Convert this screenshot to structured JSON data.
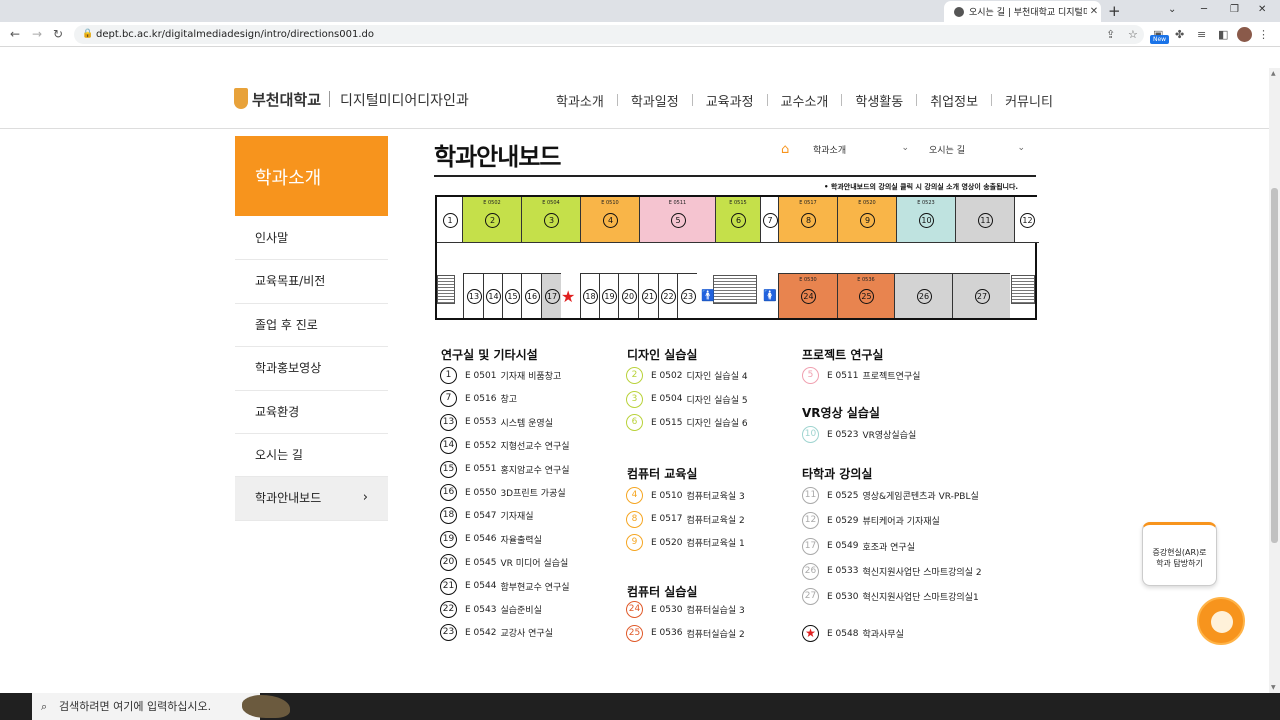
{
  "browser": {
    "tab_title": "오시는 길 | 부천대학교 디지털미",
    "url": "dept.bc.ac.kr/digitalmediadesign/intro/directions001.do",
    "new_badge": "New"
  },
  "header": {
    "school_name": "부천대학교",
    "dept_name": "디지털미디어디자인과",
    "nav": [
      "학과소개",
      "학과일정",
      "교육과정",
      "교수소개",
      "학생활동",
      "취업정보",
      "커뮤니티"
    ]
  },
  "sidebar": {
    "title": "학과소개",
    "items": [
      {
        "label": "인사말"
      },
      {
        "label": "교육목표/비전"
      },
      {
        "label": "졸업 후 진로"
      },
      {
        "label": "학과홍보영상"
      },
      {
        "label": "교육환경"
      },
      {
        "label": "오시는 길"
      },
      {
        "label": "학과안내보드"
      }
    ],
    "active_index": 6
  },
  "content": {
    "title": "학과안내보드",
    "breadcrumb": [
      "학과소개",
      "오시는 길"
    ],
    "notice": "• 학과안내보드의 강의실 클릭 시 강의실 소개 영상이 송출됩니다."
  },
  "map": {
    "top_rooms": [
      {
        "num": "1",
        "code": "",
        "color": "#ffffff"
      },
      {
        "num": "2",
        "code": "E 0502",
        "color": "#c5e04a"
      },
      {
        "num": "3",
        "code": "E 0504",
        "color": "#c5e04a"
      },
      {
        "num": "4",
        "code": "E 0510",
        "color": "#f9b548"
      },
      {
        "num": "5",
        "code": "E 0511",
        "color": "#f5c4d0"
      },
      {
        "num": "6",
        "code": "E 0515",
        "color": "#c5e04a"
      },
      {
        "num": "7",
        "code": "",
        "color": "#ffffff"
      },
      {
        "num": "8",
        "code": "E 0517",
        "color": "#f9b548"
      },
      {
        "num": "9",
        "code": "E 0520",
        "color": "#f9b548"
      },
      {
        "num": "10",
        "code": "E 0523",
        "color": "#bfe3e0"
      },
      {
        "num": "11",
        "code": "",
        "color": "#d3d3d3"
      },
      {
        "num": "12",
        "code": "",
        "color": "#ffffff"
      }
    ],
    "bottom_rooms": [
      {
        "num": "13",
        "code": "",
        "color": "#ffffff"
      },
      {
        "num": "14",
        "code": "",
        "color": "#ffffff"
      },
      {
        "num": "15",
        "code": "",
        "color": "#ffffff"
      },
      {
        "num": "16",
        "code": "",
        "color": "#ffffff"
      },
      {
        "num": "17",
        "code": "",
        "color": "#d3d3d3"
      },
      {
        "num": "18",
        "code": "",
        "color": "#ffffff"
      },
      {
        "num": "19",
        "code": "",
        "color": "#ffffff"
      },
      {
        "num": "20",
        "code": "",
        "color": "#ffffff"
      },
      {
        "num": "21",
        "code": "",
        "color": "#ffffff"
      },
      {
        "num": "22",
        "code": "",
        "color": "#ffffff"
      },
      {
        "num": "23",
        "code": "",
        "color": "#ffffff"
      },
      {
        "num": "24",
        "code": "E 0530",
        "color": "#e8844f"
      },
      {
        "num": "25",
        "code": "E 0536",
        "color": "#e8844f"
      },
      {
        "num": "26",
        "code": "",
        "color": "#d3d3d3"
      },
      {
        "num": "27",
        "code": "",
        "color": "#d3d3d3"
      }
    ]
  },
  "legend": {
    "col1": {
      "title": "연구실 및 기타시설",
      "items": [
        {
          "num": "1",
          "code": "E 0501",
          "name": "기자재 비품창고"
        },
        {
          "num": "7",
          "code": "E 0516",
          "name": "창고"
        },
        {
          "num": "13",
          "code": "E 0553",
          "name": "시스템 운영실"
        },
        {
          "num": "14",
          "code": "E 0552",
          "name": "지형선교수 연구실"
        },
        {
          "num": "15",
          "code": "E 0551",
          "name": "홍지암교수 연구실"
        },
        {
          "num": "16",
          "code": "E 0550",
          "name": "3D프린트 가공실"
        },
        {
          "num": "18",
          "code": "E 0547",
          "name": "기자재실"
        },
        {
          "num": "19",
          "code": "E 0546",
          "name": "자율출력실"
        },
        {
          "num": "20",
          "code": "E 0545",
          "name": "VR 미디어 실습실"
        },
        {
          "num": "21",
          "code": "E 0544",
          "name": "함부현교수 연구실"
        },
        {
          "num": "22",
          "code": "E 0543",
          "name": "실습준비실"
        },
        {
          "num": "23",
          "code": "E 0542",
          "name": "교강사 연구실"
        }
      ]
    },
    "col2": {
      "groups": [
        {
          "title": "디자인 실습실",
          "color": "#b9d23a",
          "items": [
            {
              "num": "2",
              "code": "E 0502",
              "name": "디자인 실습실 4"
            },
            {
              "num": "3",
              "code": "E 0504",
              "name": "디자인 실습실 5"
            },
            {
              "num": "6",
              "code": "E 0515",
              "name": "디자인 실습실 6"
            }
          ]
        },
        {
          "title": "컴퓨터 교육실",
          "color": "#f5a623",
          "items": [
            {
              "num": "4",
              "code": "E 0510",
              "name": "컴퓨터교육실 3"
            },
            {
              "num": "8",
              "code": "E 0517",
              "name": "컴퓨터교육실 2"
            },
            {
              "num": "9",
              "code": "E 0520",
              "name": "컴퓨터교육실 1"
            }
          ]
        },
        {
          "title": "컴퓨터 실습실",
          "color": "#e05a2a",
          "items": [
            {
              "num": "24",
              "code": "E 0530",
              "name": "컴퓨터실습실 3"
            },
            {
              "num": "25",
              "code": "E 0536",
              "name": "컴퓨터실습실 2"
            }
          ]
        }
      ]
    },
    "col3": {
      "groups": [
        {
          "title": "프로젝트 연구실",
          "color": "#f0a0b0",
          "items": [
            {
              "num": "5",
              "code": "E 0511",
              "name": "프로젝트연구실"
            }
          ]
        },
        {
          "title": "VR영상 실습실",
          "color": "#9fd4d0",
          "items": [
            {
              "num": "10",
              "code": "E 0523",
              "name": "VR영상실습실"
            }
          ]
        },
        {
          "title": "타학과 강의실",
          "color": "#aaaaaa",
          "items": [
            {
              "num": "11",
              "code": "E 0525",
              "name": "영상&게임콘텐츠과 VR-PBL실"
            },
            {
              "num": "12",
              "code": "E 0529",
              "name": "뷰티케어과 기자재실"
            },
            {
              "num": "17",
              "code": "E 0549",
              "name": "호조과 연구실"
            },
            {
              "num": "26",
              "code": "E 0533",
              "name": "혁신지원사업단 스마트강의실 2"
            },
            {
              "num": "27",
              "code": "E 0530",
              "name": "혁신지원사업단 스마트강의실1"
            }
          ]
        }
      ],
      "office": {
        "code": "E 0548",
        "name": "학과사무실"
      }
    }
  },
  "float": {
    "ar_label_1": "증강현실(AR)로",
    "ar_label_2": "학과 탐방하기"
  },
  "taskbar": {
    "search_placeholder": "검색하려면 여기에 입력하십시오."
  }
}
